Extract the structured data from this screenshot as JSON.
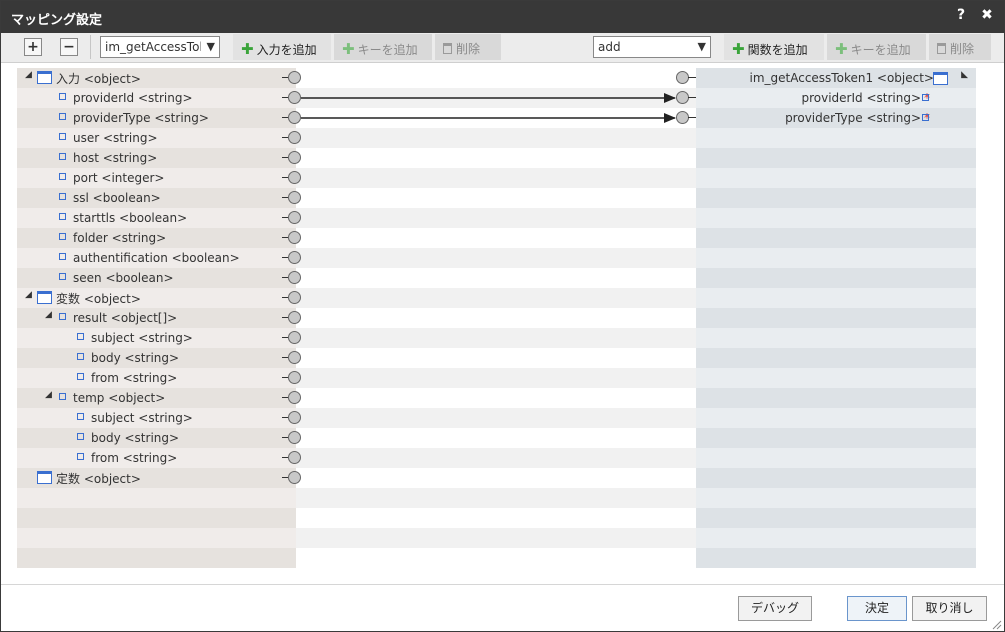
{
  "dialog": {
    "title": "マッピング設定",
    "help_label": "?",
    "close_label": "✖"
  },
  "toolbar": {
    "expand_label": "+",
    "collapse_label": "−",
    "source_select": "im_getAccessTok",
    "add_input_label": "入力を追加",
    "add_key_left_label": "キーを追加",
    "delete_left_label": "削除",
    "function_select": "add",
    "add_function_label": "関数を追加",
    "add_key_right_label": "キーを追加",
    "delete_right_label": "削除"
  },
  "left_tree": [
    {
      "label": "入力 <object>",
      "type": "object",
      "expanded": true
    },
    {
      "label": "providerId <string>",
      "type": "field"
    },
    {
      "label": "providerType <string>",
      "type": "field"
    },
    {
      "label": "user <string>",
      "type": "field"
    },
    {
      "label": "host <string>",
      "type": "field"
    },
    {
      "label": "port <integer>",
      "type": "field"
    },
    {
      "label": "ssl <boolean>",
      "type": "field"
    },
    {
      "label": "starttls <boolean>",
      "type": "field"
    },
    {
      "label": "folder <string>",
      "type": "field"
    },
    {
      "label": "authentification <boolean>",
      "type": "field"
    },
    {
      "label": "seen <boolean>",
      "type": "field"
    },
    {
      "label": "変数 <object>",
      "type": "object",
      "expanded": true
    },
    {
      "label": "result <object[]>",
      "type": "field",
      "expanded": true
    },
    {
      "label": "subject <string>",
      "type": "field"
    },
    {
      "label": "body <string>",
      "type": "field"
    },
    {
      "label": "from <string>",
      "type": "field"
    },
    {
      "label": "temp <object>",
      "type": "field",
      "expanded": true
    },
    {
      "label": "subject <string>",
      "type": "field"
    },
    {
      "label": "body <string>",
      "type": "field"
    },
    {
      "label": "from <string>",
      "type": "field"
    },
    {
      "label": "定数 <object>",
      "type": "object"
    }
  ],
  "right_tree": [
    {
      "label": "im_getAccessToken1 <object>",
      "type": "object",
      "expanded": true
    },
    {
      "label": "providerId <string>",
      "required_mark": "*",
      "type": "field"
    },
    {
      "label": "providerType <string>",
      "required_mark": "*",
      "type": "field"
    }
  ],
  "mappings": [
    {
      "from": "providerId <string>",
      "to": "providerId <string>"
    },
    {
      "from": "providerType <string>",
      "to": "providerType <string>"
    }
  ],
  "footer": {
    "debug_label": "デバッグ",
    "ok_label": "決定",
    "cancel_label": "取り消し"
  },
  "colors": {
    "titlebar": "#383838",
    "add_icon": "#3aa43a",
    "node_icon": "#3a6fd0",
    "required": "#d33333"
  }
}
